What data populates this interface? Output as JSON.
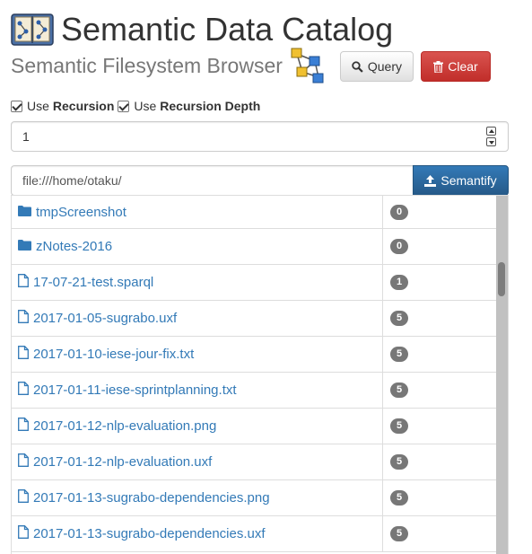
{
  "header": {
    "title": "Semantic Data Catalog",
    "subtitle": "Semantic Filesystem Browser",
    "query_label": "Query",
    "clear_label": "Clear"
  },
  "options": {
    "use_label_1": "Use",
    "recursion_label": "Recursion",
    "use_label_2": "Use",
    "recursion_depth_label": "Recursion Depth",
    "recursion_checked": true,
    "recursion_depth_checked": true
  },
  "depth_input": {
    "value": "1"
  },
  "path": {
    "value": "file:///home/otaku/",
    "semantify_label": "Semantify"
  },
  "files": [
    {
      "name": "tmpScreenshot",
      "type": "folder",
      "count": "0"
    },
    {
      "name": "zNotes-2016",
      "type": "folder",
      "count": "0"
    },
    {
      "name": "17-07-21-test.sparql",
      "type": "file",
      "count": "1"
    },
    {
      "name": "2017-01-05-sugrabo.uxf",
      "type": "file",
      "count": "5"
    },
    {
      "name": "2017-01-10-iese-jour-fix.txt",
      "type": "file",
      "count": "5"
    },
    {
      "name": "2017-01-11-iese-sprintplanning.txt",
      "type": "file",
      "count": "5"
    },
    {
      "name": "2017-01-12-nlp-evaluation.png",
      "type": "file",
      "count": "5"
    },
    {
      "name": "2017-01-12-nlp-evaluation.uxf",
      "type": "file",
      "count": "5"
    },
    {
      "name": "2017-01-13-sugrabo-dependencies.png",
      "type": "file",
      "count": "5"
    },
    {
      "name": "2017-01-13-sugrabo-dependencies.uxf",
      "type": "file",
      "count": "5"
    }
  ],
  "colors": {
    "link": "#337ab7",
    "primary": "#337ab7",
    "danger": "#d9534f",
    "badge": "#777777"
  },
  "icons": {
    "logo": "book-graph-icon",
    "network": "network-graph-icon",
    "query": "search-icon",
    "clear": "trash-icon",
    "semantify": "upload-icon",
    "folder": "folder-icon",
    "file": "file-icon"
  }
}
